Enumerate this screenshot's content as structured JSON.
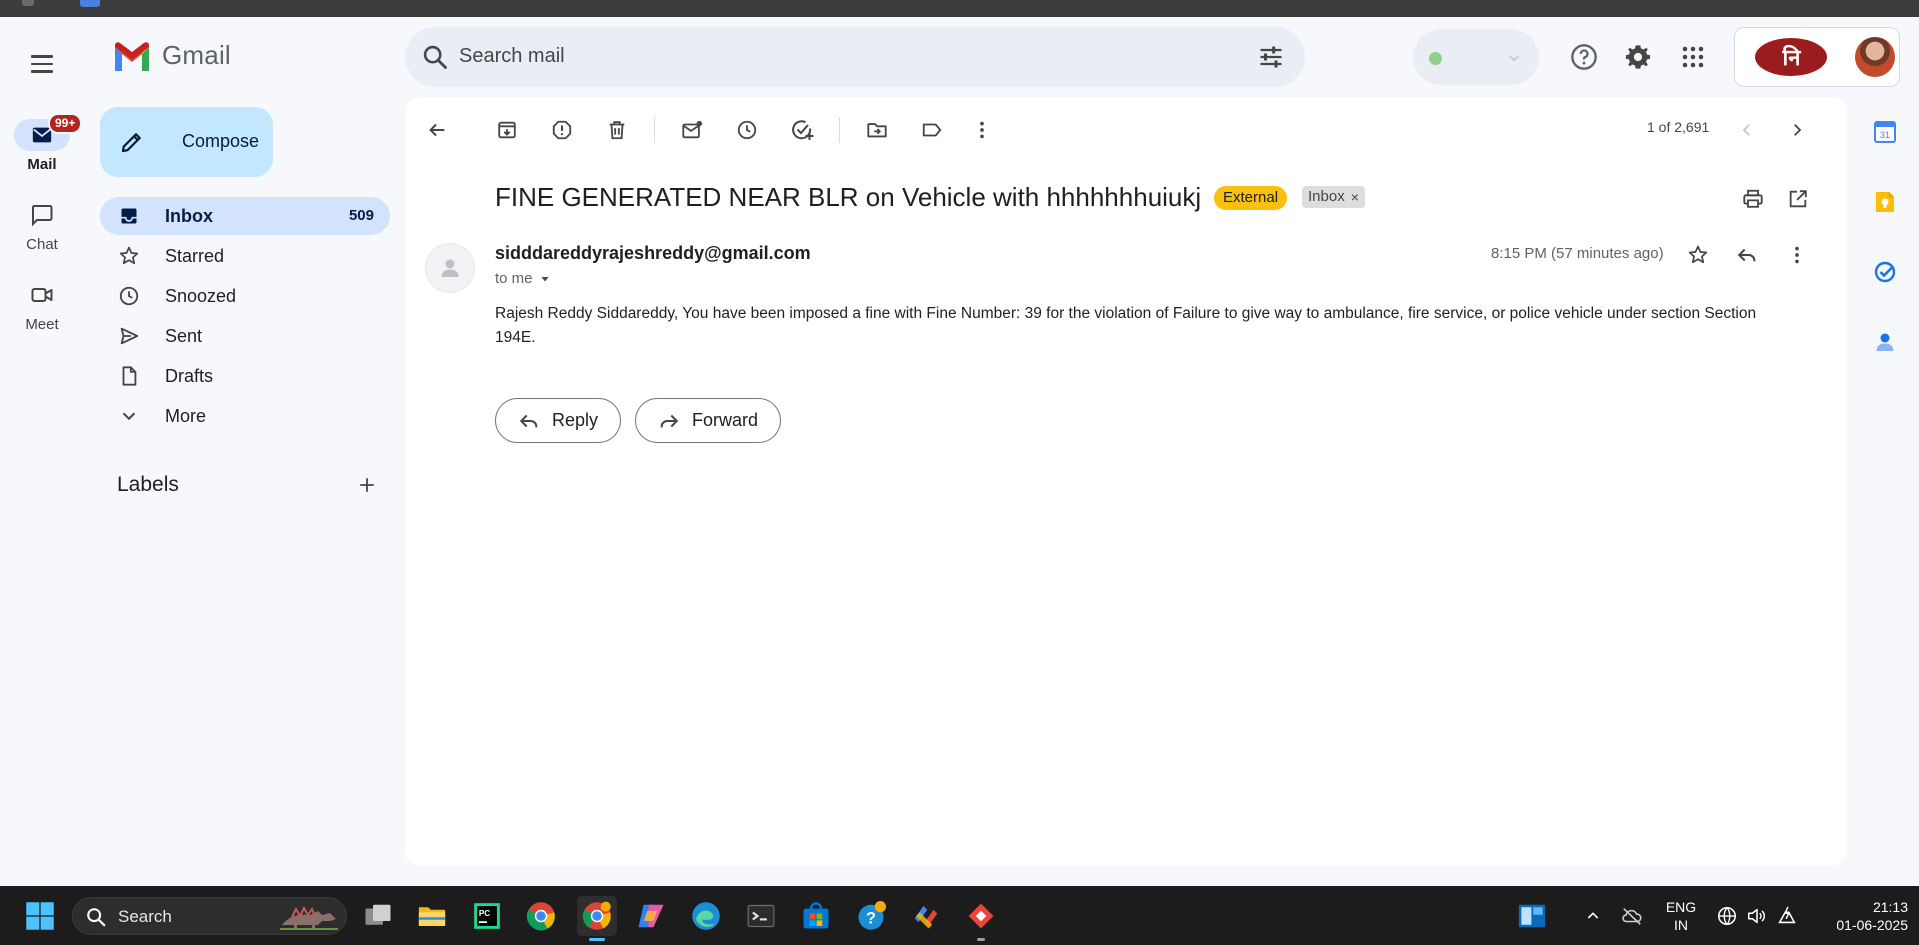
{
  "app": {
    "name": "Gmail",
    "menu_icon": "hamburger-menu-icon",
    "logo_icon": "gmail-m-logo"
  },
  "search": {
    "placeholder": "Search mail",
    "icon": "search-icon",
    "options_icon": "tune-icon"
  },
  "header": {
    "status_color": "#8fd18c",
    "help_icon": "help-icon",
    "settings_icon": "gear-icon",
    "apps_icon": "apps-grid-icon",
    "account_logo_text": "नि"
  },
  "rail": {
    "items": [
      {
        "label": "Mail",
        "icon": "mail-icon",
        "badge": "99+",
        "active": true
      },
      {
        "label": "Chat",
        "icon": "chat-icon",
        "active": false
      },
      {
        "label": "Meet",
        "icon": "video-icon",
        "active": false
      }
    ]
  },
  "sidebar": {
    "compose_label": "Compose",
    "items": [
      {
        "label": "Inbox",
        "count": "509",
        "icon": "inbox-icon",
        "active": true
      },
      {
        "label": "Starred",
        "icon": "star-icon"
      },
      {
        "label": "Snoozed",
        "icon": "clock-icon"
      },
      {
        "label": "Sent",
        "icon": "send-icon"
      },
      {
        "label": "Drafts",
        "icon": "draft-icon"
      },
      {
        "label": "More",
        "icon": "chevron-down-icon"
      }
    ],
    "labels_title": "Labels"
  },
  "toolbar": {
    "pager": "1 of 2,691"
  },
  "email": {
    "subject": "FINE GENERATED NEAR BLR on Vehicle with hhhhhhhuiukj",
    "tags": {
      "external": "External",
      "inbox": "Inbox",
      "remove": "×"
    },
    "sender": "sidddareddyrajeshreddy@gmail.com",
    "to": "to me",
    "time": "8:15 PM (57 minutes ago)",
    "body": "Rajesh Reddy Siddareddy, You have been imposed a fine with Fine Number: 39 for the violation of Failure to give way to ambulance, fire service, or police vehicle under section Section 194E.",
    "reply_label": "Reply",
    "forward_label": "Forward"
  },
  "taskbar": {
    "search_label": "Search",
    "lang_top": "ENG",
    "lang_bottom": "IN",
    "clock_time": "21:13",
    "clock_date": "01-06-2025"
  },
  "colors": {
    "accent": "#0b57d0",
    "compose_bg": "#c2e7ff",
    "active_nav_bg": "#d3e3fd",
    "external_tag": "#f9c00f",
    "badge": "#b3261e"
  }
}
